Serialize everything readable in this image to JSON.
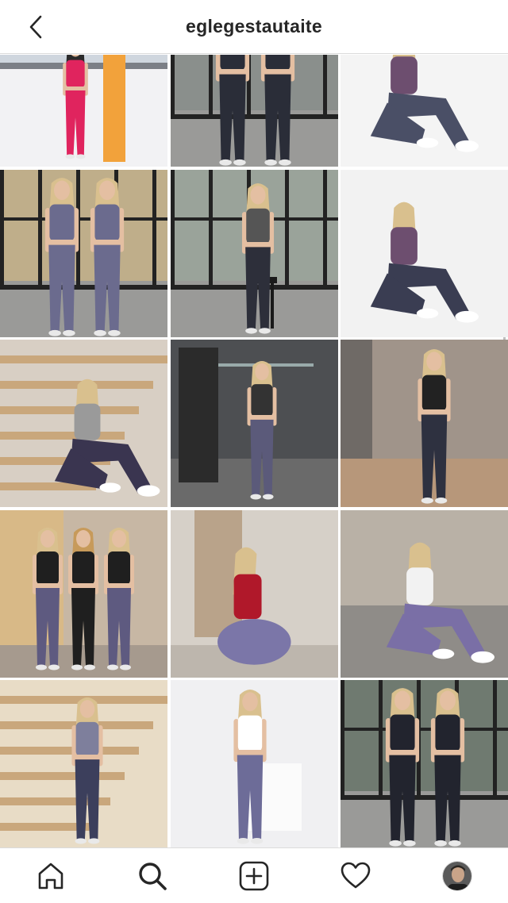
{
  "header": {
    "title": "eglegestautaite",
    "back_icon": "chevron-left-icon"
  },
  "grid": {
    "posts": [
      {
        "theme": "snowboard",
        "bg": "#f2f2f4",
        "accent": "#e0245e",
        "figures": 1
      },
      {
        "theme": "window-duo",
        "bg": "#8a8f8c",
        "accent": "#2a2d38",
        "figures": 2
      },
      {
        "theme": "studio-sit",
        "bg": "#f4f4f4",
        "accent": "#4a4f66",
        "figures": 1
      },
      {
        "theme": "window-duo",
        "bg": "#bfae8a",
        "accent": "#6b6b8e",
        "figures": 2
      },
      {
        "theme": "window-stool",
        "bg": "#9aa39a",
        "accent": "#2d2f3a",
        "figures": 1
      },
      {
        "theme": "studio-sit",
        "bg": "#f2f2f2",
        "accent": "#3a3d52",
        "figures": 1
      },
      {
        "theme": "stairs",
        "bg": "#d8cfc4",
        "accent": "#3a3550",
        "figures": 1
      },
      {
        "theme": "gym",
        "bg": "#4d4f52",
        "accent": "#5b5a7a",
        "figures": 1
      },
      {
        "theme": "hallway",
        "bg": "#a0948a",
        "accent": "#2e3140",
        "figures": 1
      },
      {
        "theme": "trio",
        "bg": "#c7b7a4",
        "accent": "#5e5a80",
        "figures": 3
      },
      {
        "theme": "kneel-red",
        "bg": "#d6d0c8",
        "accent": "#b0182a",
        "figures": 1
      },
      {
        "theme": "floor-white",
        "bg": "#b9b1a6",
        "accent": "#7a6fa6",
        "figures": 1
      },
      {
        "theme": "stairs-light",
        "bg": "#e8dcc6",
        "accent": "#3c3f5c",
        "figures": 1
      },
      {
        "theme": "studio-stand",
        "bg": "#f0f0f2",
        "accent": "#6d6c98",
        "figures": 1
      },
      {
        "theme": "window-duo",
        "bg": "#6f7a70",
        "accent": "#22242e",
        "figures": 2
      }
    ]
  },
  "nav": {
    "items": [
      {
        "name": "home",
        "icon": "home-icon"
      },
      {
        "name": "search",
        "icon": "search-icon"
      },
      {
        "name": "new-post",
        "icon": "plus-square-icon"
      },
      {
        "name": "activity",
        "icon": "heart-icon"
      },
      {
        "name": "profile",
        "icon": "avatar-icon"
      }
    ]
  }
}
